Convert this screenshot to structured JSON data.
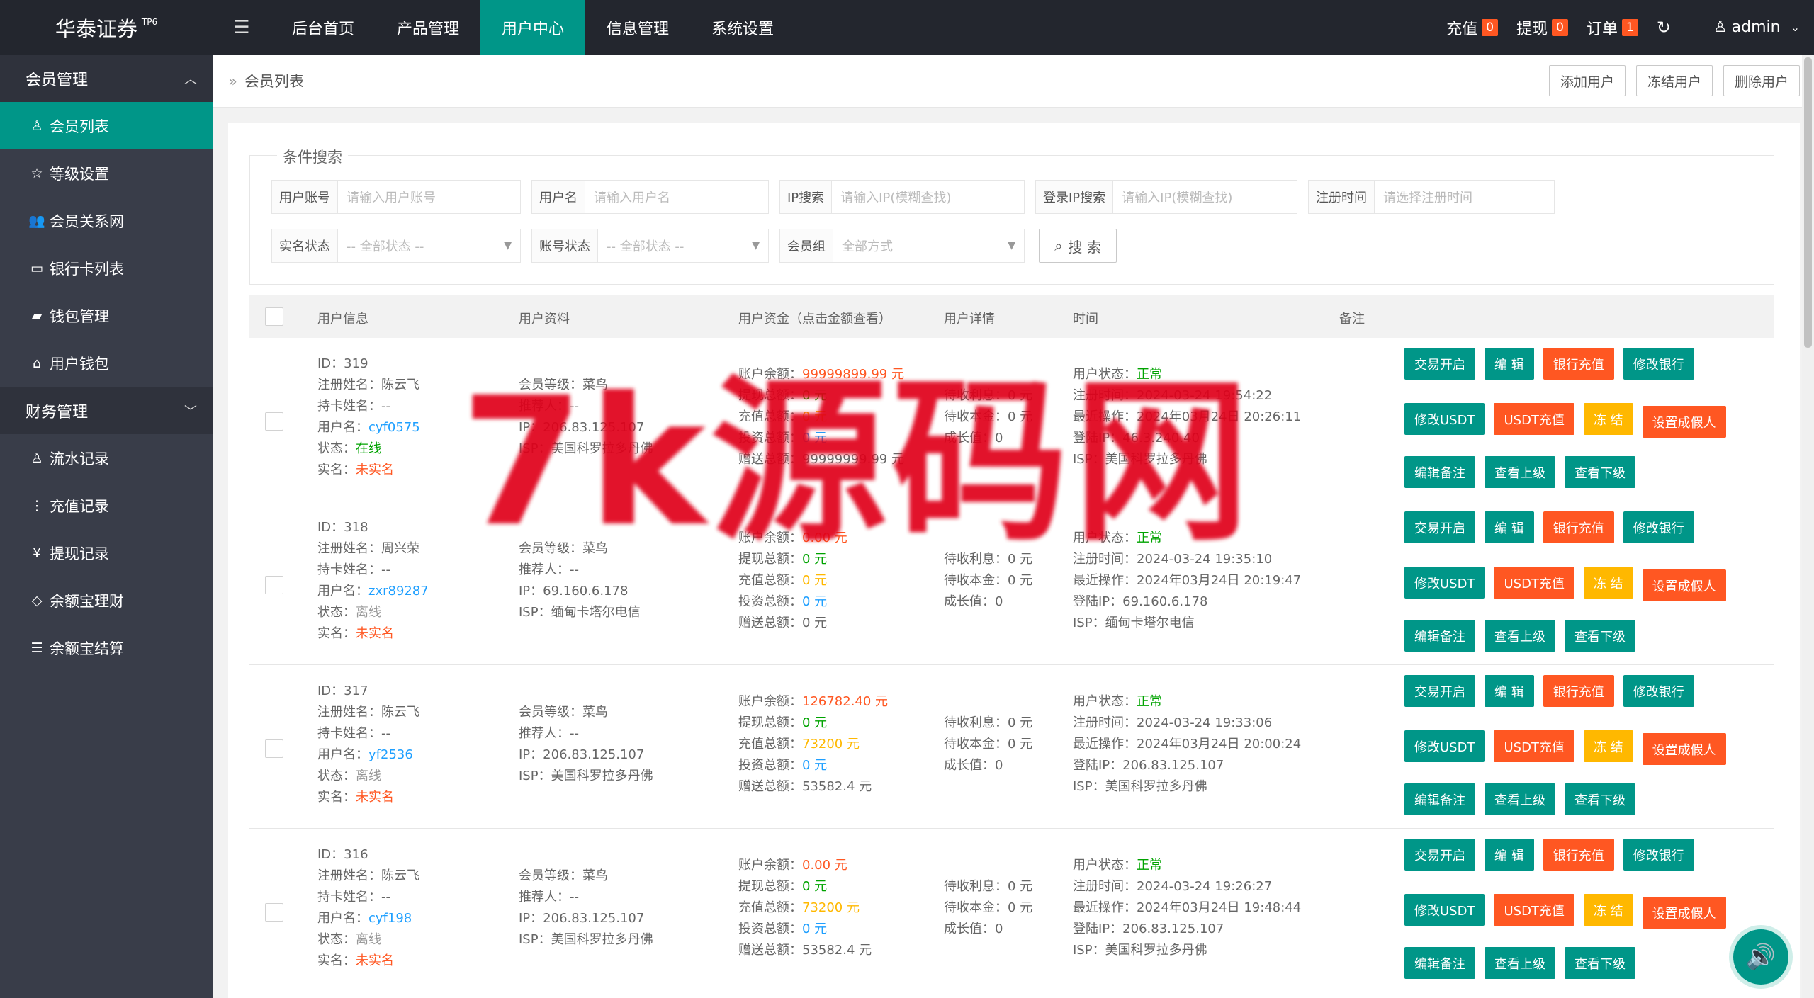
{
  "app": {
    "logo": "华泰证券",
    "logo_sup": "TP6",
    "menu_icon": "hamburger-icon"
  },
  "nav": [
    "后台首页",
    "产品管理",
    "用户中心",
    "信息管理",
    "系统设置"
  ],
  "top": {
    "recharge_label": "充值",
    "recharge_count": "0",
    "withdraw_label": "提现",
    "withdraw_count": "0",
    "order_label": "订单",
    "order_count": "1",
    "user": "admin"
  },
  "sidebar": {
    "group1": "会员管理",
    "items1": [
      {
        "label": "会员列表",
        "icon": "user-icon",
        "glyph": "♙"
      },
      {
        "label": "等级设置",
        "icon": "star-icon",
        "glyph": "☆"
      },
      {
        "label": "会员关系网",
        "icon": "users-icon",
        "glyph": "👥"
      },
      {
        "label": "银行卡列表",
        "icon": "card-icon",
        "glyph": "▭"
      },
      {
        "label": "钱包管理",
        "icon": "wallet-icon",
        "glyph": "▰"
      },
      {
        "label": "用户钱包",
        "icon": "wallet2-icon",
        "glyph": "⌂"
      }
    ],
    "group2": "财务管理",
    "items2": [
      {
        "label": "流水记录",
        "icon": "user-icon",
        "glyph": "♙"
      },
      {
        "label": "充值记录",
        "icon": "dots-icon",
        "glyph": "⋮"
      },
      {
        "label": "提现记录",
        "icon": "yen-icon",
        "glyph": "¥"
      },
      {
        "label": "余额宝理财",
        "icon": "diamond-icon",
        "glyph": "◇"
      },
      {
        "label": "余额宝结算",
        "icon": "list-icon",
        "glyph": "☰"
      }
    ]
  },
  "breadcrumb": "会员列表",
  "bar_buttons": [
    "添加用户",
    "冻结用户",
    "删除用户"
  ],
  "search": {
    "legend": "条件搜索",
    "fields": [
      {
        "label": "用户账号",
        "placeholder": "请输入用户账号"
      },
      {
        "label": "用户名",
        "placeholder": "请输入用户名"
      },
      {
        "label": "IP搜索",
        "placeholder": "请输入IP(模糊查找)"
      },
      {
        "label": "登录IP搜索",
        "placeholder": "请输入IP(模糊查找)"
      },
      {
        "label": "注册时间",
        "placeholder": "请选择注册时间"
      }
    ],
    "selects": [
      {
        "label": "实名状态",
        "value": "-- 全部状态 --"
      },
      {
        "label": "账号状态",
        "value": "-- 全部状态 --"
      },
      {
        "label": "会员组",
        "value": "全部方式"
      }
    ],
    "button": "搜 索"
  },
  "table": {
    "headers": [
      "用户信息",
      "用户资料",
      "用户资金（点击金额查看）",
      "用户详情",
      "时间",
      "备注"
    ],
    "actions": {
      "row1": [
        "交易开启",
        "编 辑",
        "银行充值",
        "修改银行"
      ],
      "row2": [
        "修改USDT",
        "USDT充值",
        "冻 结",
        "设置成假人"
      ],
      "row3": [
        "编辑备注",
        "查看上级",
        "查看下级"
      ]
    },
    "rows": [
      {
        "id": "ID：319",
        "reg_name": "注册姓名：陈云飞",
        "card_name": "持卡姓名：--",
        "username_label": "用户名：",
        "username": "cyf0575",
        "status_label": "状态：",
        "status": "在线",
        "real_label": "实名：",
        "real": "未实名",
        "level": "会员等级：菜鸟",
        "referrer": "推荐人：--",
        "ip": "IP：206.83.125.107",
        "isp": "ISP：美国科罗拉多丹佛",
        "balance_label": "账户余额：",
        "balance": "99999899.99 元",
        "withdraw_label": "提现总额：",
        "withdraw": "0 元",
        "recharge_label": "充值总额：",
        "recharge": "0 元",
        "invest_label": "投资总额：",
        "invest": "0 元",
        "gift_label": "赠送总额：",
        "gift": "99999999.99 元",
        "interest": "待收利息：0 元",
        "principal": "待收本金：0 元",
        "growth": "成长值：0",
        "ustatus_label": "用户状态：",
        "ustatus": "正常",
        "regtime": "注册时间：2024-03-24 19:54:22",
        "lastop": "最近操作：2024年03月24日 20:26:11",
        "loginip": "登陆IP：46.3.240.40",
        "isp2": "ISP：美国科罗拉多丹佛"
      },
      {
        "id": "ID：318",
        "reg_name": "注册姓名：周兴荣",
        "card_name": "持卡姓名：--",
        "username_label": "用户名：",
        "username": "zxr89287",
        "status_label": "状态：",
        "status": "离线",
        "real_label": "实名：",
        "real": "未实名",
        "level": "会员等级：菜鸟",
        "referrer": "推荐人：--",
        "ip": "IP：69.160.6.178",
        "isp": "ISP：缅甸卡塔尔电信",
        "balance_label": "账户余额：",
        "balance": "0.00 元",
        "withdraw_label": "提现总额：",
        "withdraw": "0 元",
        "recharge_label": "充值总额：",
        "recharge": "0 元",
        "invest_label": "投资总额：",
        "invest": "0 元",
        "gift_label": "赠送总额：",
        "gift": "0 元",
        "interest": "待收利息：0 元",
        "principal": "待收本金：0 元",
        "growth": "成长值：0",
        "ustatus_label": "用户状态：",
        "ustatus": "正常",
        "regtime": "注册时间：2024-03-24 19:35:10",
        "lastop": "最近操作：2024年03月24日 20:19:47",
        "loginip": "登陆IP：69.160.6.178",
        "isp2": "ISP：缅甸卡塔尔电信"
      },
      {
        "id": "ID：317",
        "reg_name": "注册姓名：陈云飞",
        "card_name": "持卡姓名：--",
        "username_label": "用户名：",
        "username": "yf2536",
        "status_label": "状态：",
        "status": "离线",
        "real_label": "实名：",
        "real": "未实名",
        "level": "会员等级：菜鸟",
        "referrer": "推荐人：--",
        "ip": "IP：206.83.125.107",
        "isp": "ISP：美国科罗拉多丹佛",
        "balance_label": "账户余额：",
        "balance": "126782.40 元",
        "withdraw_label": "提现总额：",
        "withdraw": "0 元",
        "recharge_label": "充值总额：",
        "recharge": "73200 元",
        "invest_label": "投资总额：",
        "invest": "0 元",
        "gift_label": "赠送总额：",
        "gift": "53582.4 元",
        "interest": "待收利息：0 元",
        "principal": "待收本金：0 元",
        "growth": "成长值：0",
        "ustatus_label": "用户状态：",
        "ustatus": "正常",
        "regtime": "注册时间：2024-03-24 19:33:06",
        "lastop": "最近操作：2024年03月24日 20:00:24",
        "loginip": "登陆IP：206.83.125.107",
        "isp2": "ISP：美国科罗拉多丹佛"
      },
      {
        "id": "ID：316",
        "reg_name": "注册姓名：陈云飞",
        "card_name": "持卡姓名：--",
        "username_label": "用户名：",
        "username": "cyf198",
        "status_label": "状态：",
        "status": "离线",
        "real_label": "实名：",
        "real": "未实名",
        "level": "会员等级：菜鸟",
        "referrer": "推荐人：--",
        "ip": "IP：206.83.125.107",
        "isp": "ISP：美国科罗拉多丹佛",
        "balance_label": "账户余额：",
        "balance": "0.00 元",
        "withdraw_label": "提现总额：",
        "withdraw": "0 元",
        "recharge_label": "充值总额：",
        "recharge": "73200 元",
        "invest_label": "投资总额：",
        "invest": "0 元",
        "gift_label": "赠送总额：",
        "gift": "53582.4 元",
        "interest": "待收利息：0 元",
        "principal": "待收本金：0 元",
        "growth": "成长值：0",
        "ustatus_label": "用户状态：",
        "ustatus": "正常",
        "regtime": "注册时间：2024-03-24 19:26:27",
        "lastop": "最近操作：2024年03月24日 19:48:44",
        "loginip": "登陆IP：206.83.125.107",
        "isp2": "ISP：美国科罗拉多丹佛"
      }
    ]
  },
  "watermark": "7k源码网",
  "colors": {
    "accent": "#009688",
    "danger": "#ff5722",
    "warn": "#ffb800",
    "info": "#1e9fff",
    "sidebar": "#393d49",
    "topbar": "#23262e"
  }
}
